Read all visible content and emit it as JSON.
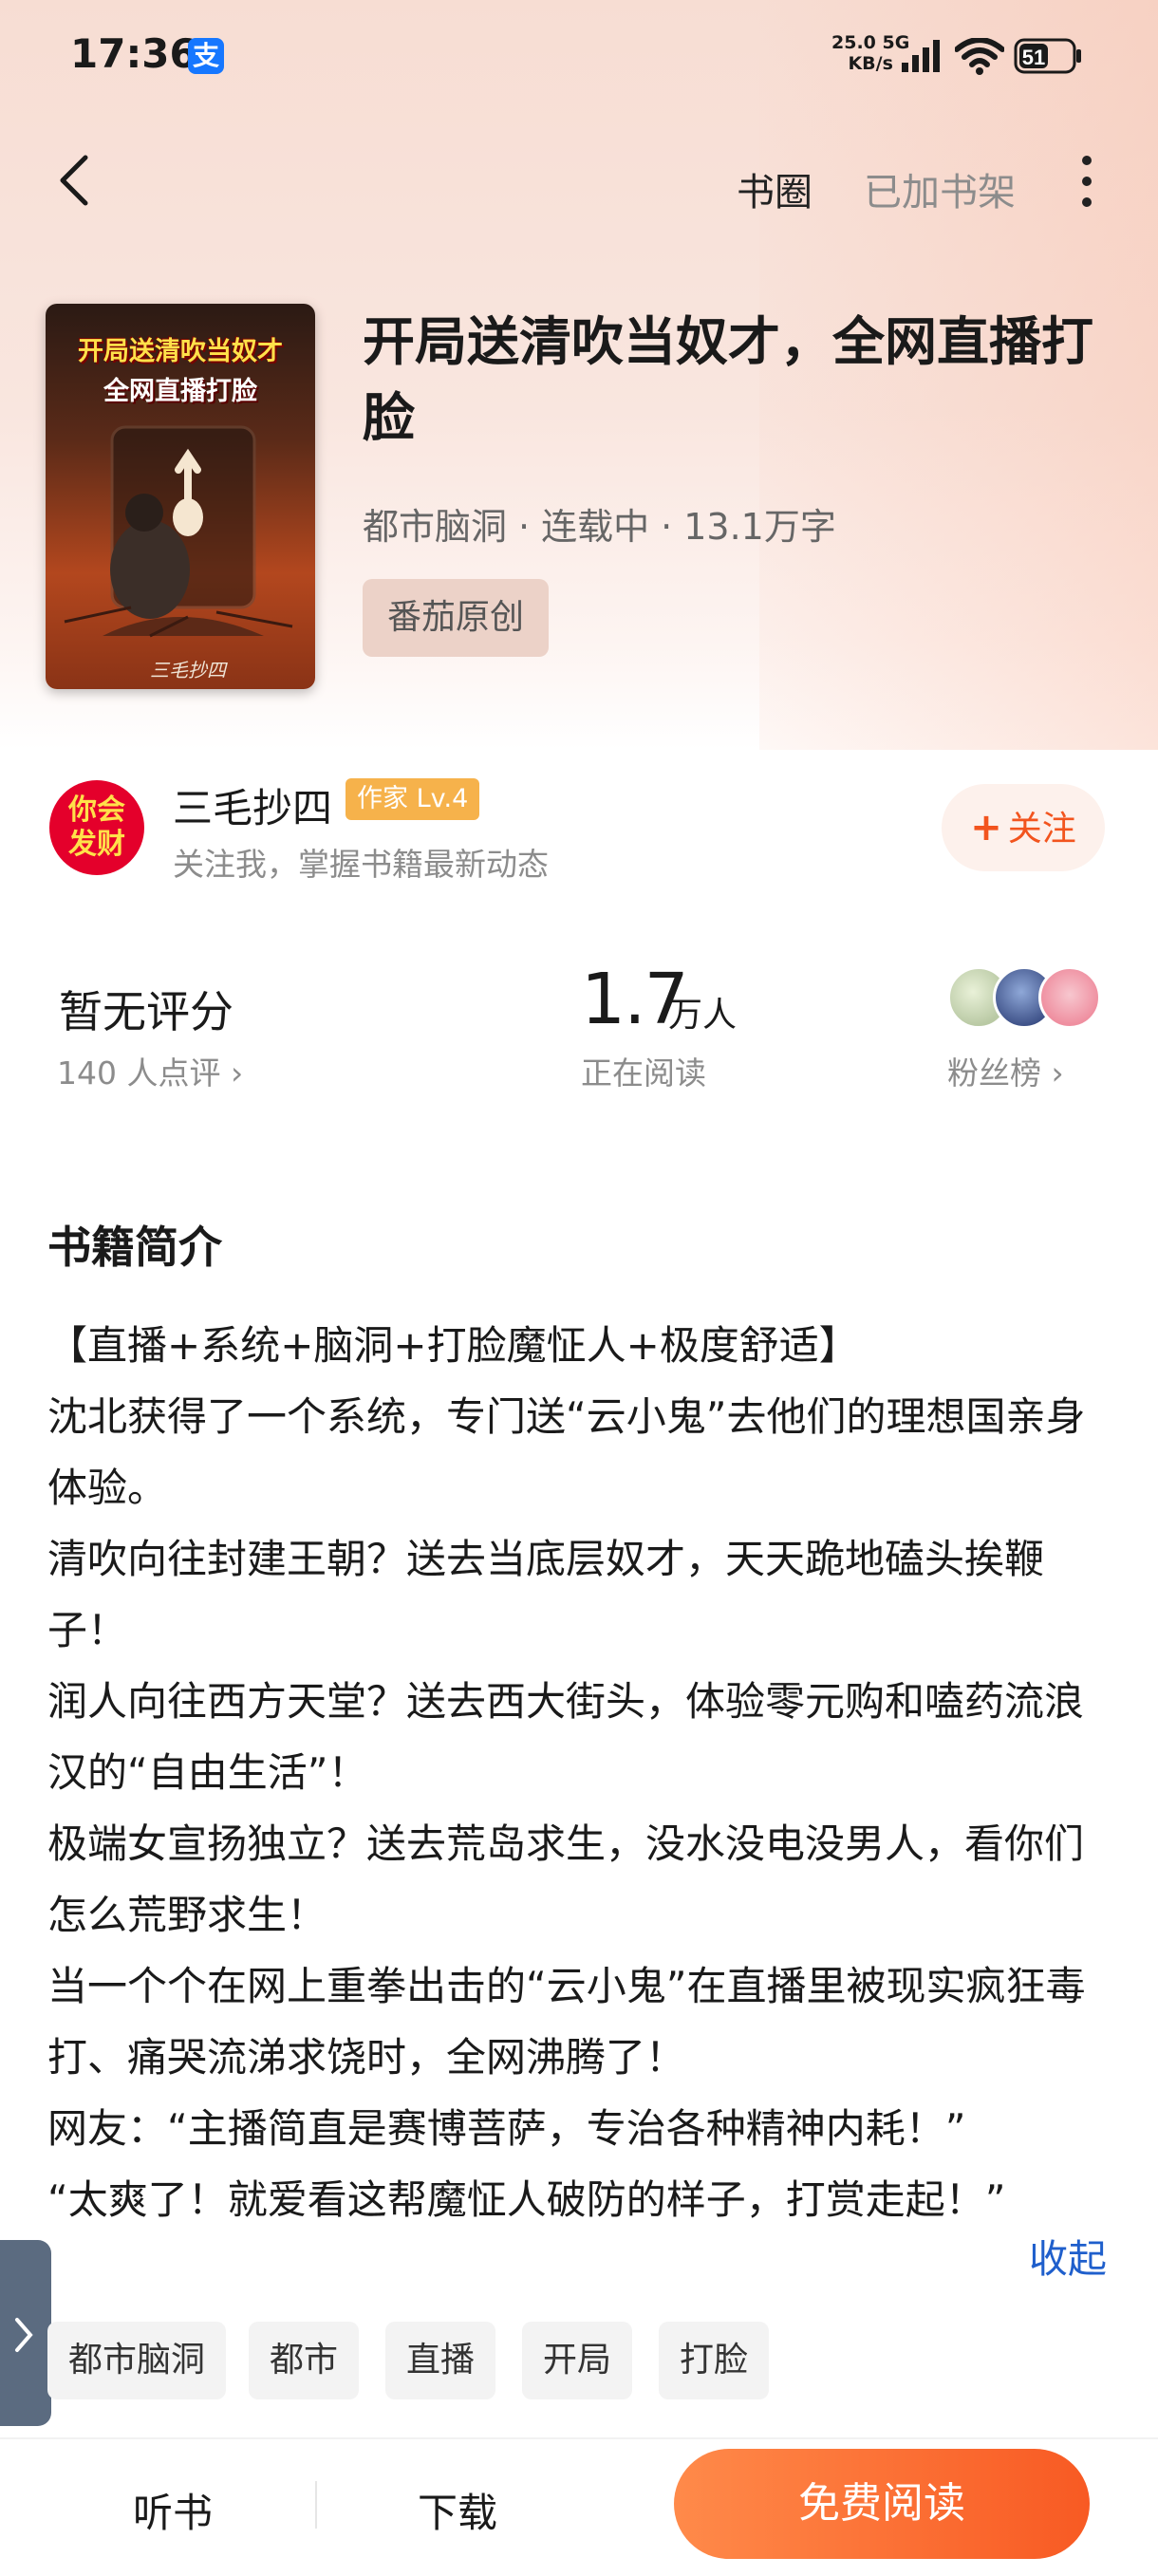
{
  "status_bar": {
    "time": "17:36",
    "app_badge": "支",
    "net_speed_value": "25.0",
    "net_speed_network": "5G",
    "net_speed_unit": "KB/s",
    "battery": "51"
  },
  "nav": {
    "shuquan": "书圈",
    "added_to_shelf": "已加书架"
  },
  "book": {
    "cover_title_line1": "开局送清吹当奴才",
    "cover_title_line2": "全网直播打脸",
    "cover_author": "三毛抄四",
    "title": "开局送清吹当奴才，全网直播打脸",
    "category": "都市脑洞",
    "status": "连载中",
    "word_count": "13.1万字",
    "meta_separator": "·",
    "source_tag": "番茄原创"
  },
  "author": {
    "avatar_line1": "你会",
    "avatar_line2": "发财",
    "name": "三毛抄四",
    "level": "作家 Lv.4",
    "subtitle": "关注我，掌握书籍最新动态",
    "follow_plus": "+",
    "follow_label": "关注"
  },
  "stats": {
    "rating": "暂无评分",
    "rating_count": "140 人点评 ›",
    "readers_value": "1.7",
    "readers_unit": "万人",
    "readers_label": "正在阅读",
    "fans_label": "粉丝榜 ›"
  },
  "intro": {
    "heading": "书籍简介",
    "paragraphs": [
      "【直播+系统+脑洞+打脸魔怔人+极度舒适】",
      "沈北获得了一个系统，专门送“云小鬼”去他们的理想国亲身体验。",
      "清吹向往封建王朝？送去当底层奴才，天天跪地磕头挨鞭子！",
      "润人向往西方天堂？送去西大街头，体验零元购和嗑药流浪汉的“自由生活”！",
      "极端女宣扬独立？送去荒岛求生，没水没电没男人，看你们怎么荒野求生！",
      "当一个个在网上重拳出击的“云小鬼”在直播里被现实疯狂毒打、痛哭流涕求饶时，全网沸腾了！",
      "网友：“主播简直是赛博菩萨，专治各种精神内耗！”",
      "“太爽了！就爱看这帮魔怔人破防的样子，打赏走起！”"
    ],
    "collapse": "收起"
  },
  "tags": [
    "都市脑洞",
    "都市",
    "直播",
    "开局",
    "打脸"
  ],
  "bottom_bar": {
    "listen": "听书",
    "download": "下载",
    "read": "免费阅读"
  },
  "colors": {
    "accent": "#f85a23",
    "link": "#1f5fcc",
    "level_badge": "#f6b24b"
  }
}
